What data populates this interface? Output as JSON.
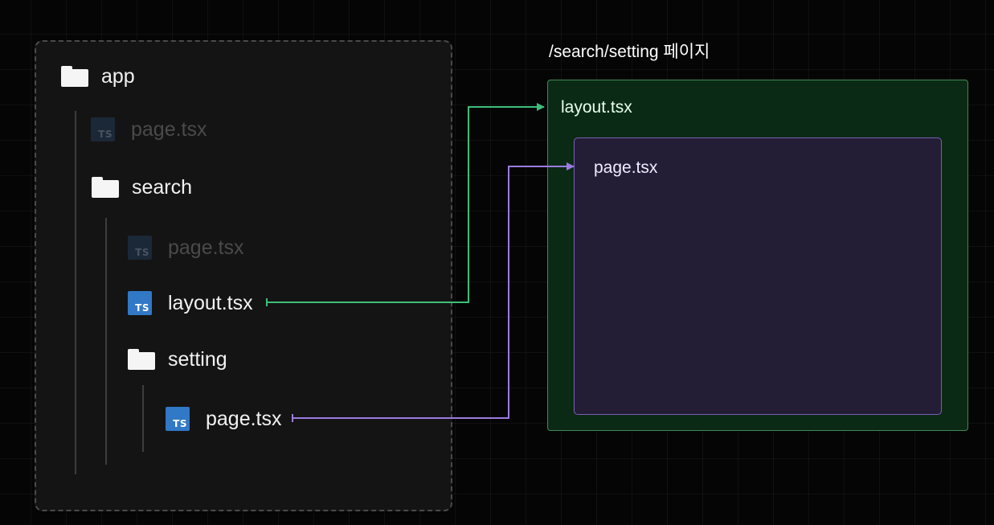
{
  "tree": {
    "app_folder": "app",
    "app_page": "page.tsx",
    "search_folder": "search",
    "search_page": "page.tsx",
    "search_layout": "layout.tsx",
    "setting_folder": "setting",
    "setting_page": "page.tsx",
    "ts_badge": "TS"
  },
  "preview": {
    "route_title": "/search/setting 페이지",
    "layout_label": "layout.tsx",
    "page_label": "page.tsx"
  },
  "colors": {
    "layout_link": "#3dbf7a",
    "page_link": "#9b7be0",
    "layout_box_fill": "#0b2a15",
    "page_box_fill": "#231d35",
    "ts_blue": "#3178c6"
  },
  "icons": [
    "folder-icon",
    "typescript-file-icon"
  ]
}
